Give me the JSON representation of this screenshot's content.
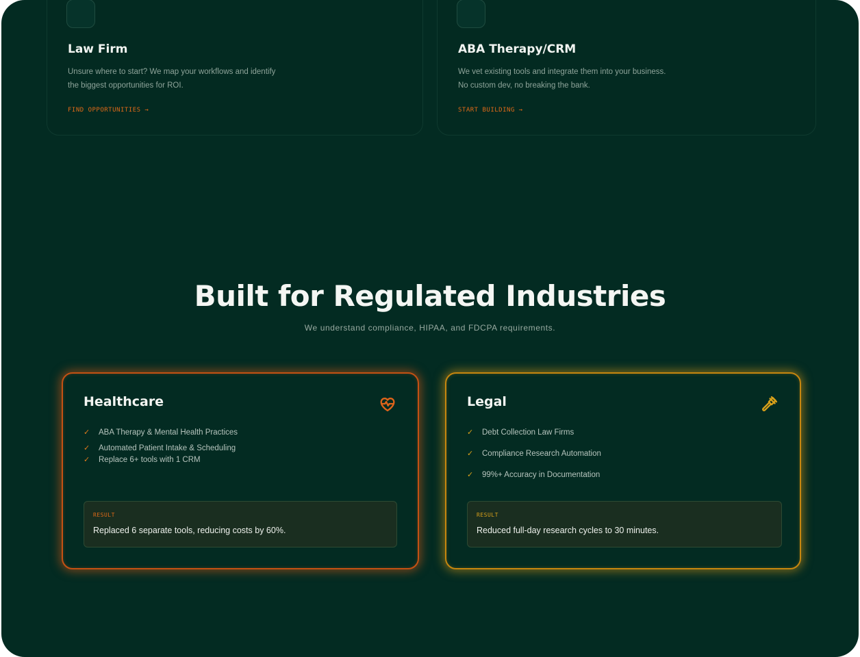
{
  "services": [
    {
      "title": "Law Firm",
      "description": "Unsure where to start? We map your workflows and identify the biggest opportunities for ROI.",
      "link": "FIND OPPORTUNITIES →"
    },
    {
      "title": "ABA Therapy/CRM",
      "description": "We vet existing tools and integrate them into your business. No custom dev, no breaking the bank.",
      "link": "START BUILDING →"
    }
  ],
  "section": {
    "title": "Built for Regulated Industries",
    "subtitle": "We understand compliance, HIPAA, and FDCPA requirements."
  },
  "industries": [
    {
      "title": "Healthcare",
      "icon": "heart-pulse-icon",
      "accent": "#e0641a",
      "items": [
        "ABA Therapy & Mental Health Practices",
        "Automated Patient Intake & Scheduling",
        "Replace 6+ tools with 1 CRM"
      ],
      "result_label": "RESULT",
      "result_text": "Replaced 6 separate tools, reducing costs by 60%."
    },
    {
      "title": "Legal",
      "icon": "gavel-icon",
      "accent": "#d9a01a",
      "items": [
        "Debt Collection Law Firms",
        "Compliance Research Automation",
        "99%+ Accuracy in Documentation"
      ],
      "result_label": "RESULT",
      "result_text": "Reduced full-day research cycles to 30 minutes."
    }
  ],
  "colors": {
    "background": "#032b22",
    "text_primary": "#f3f5f2",
    "accent_orange": "#e0641a",
    "accent_gold": "#d9a01a"
  }
}
